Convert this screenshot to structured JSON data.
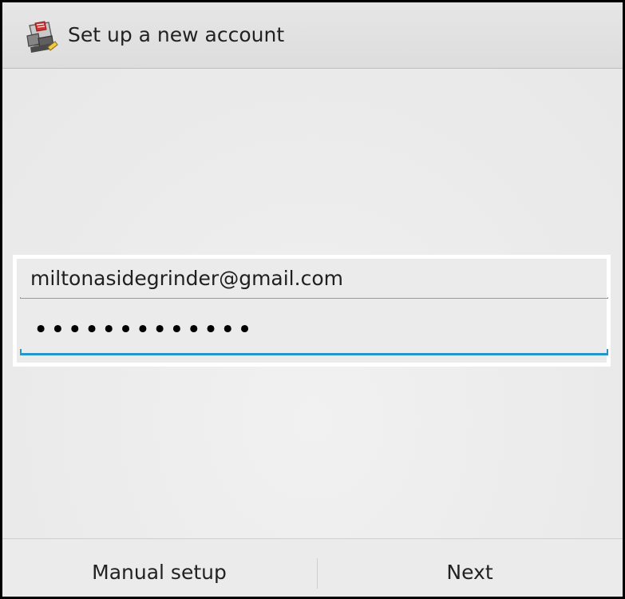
{
  "screen": {
    "title": "Set up a new account",
    "app_icon": "email-app-icon"
  },
  "form": {
    "email_value": "miltonasidegrinder@gmail.com",
    "password_mask": "•••••••••••••"
  },
  "actions": {
    "manual_setup_label": "Manual setup",
    "next_label": "Next"
  },
  "colors": {
    "focus_underline": "#2496c7",
    "background": "#ebebeb",
    "text": "#222222"
  }
}
